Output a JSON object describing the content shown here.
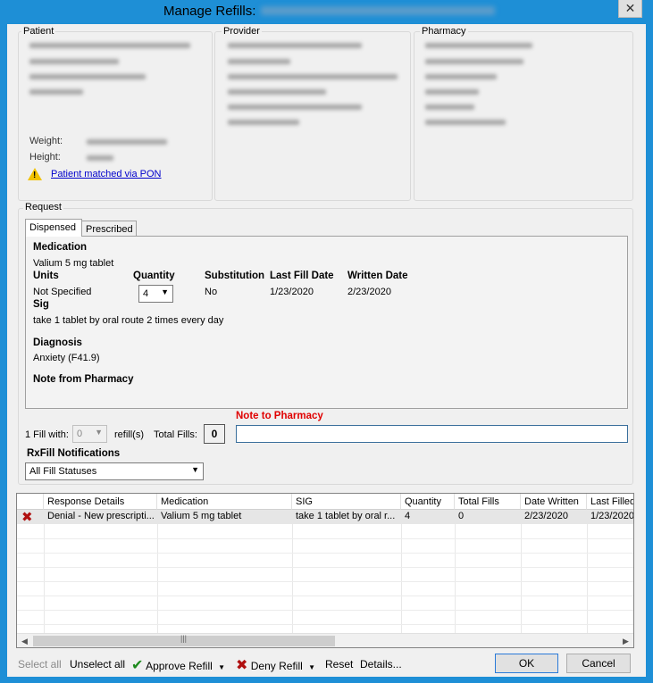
{
  "window": {
    "title": "Manage Refills:",
    "close_glyph": "✕"
  },
  "patient": {
    "label": "Patient",
    "weight_label": "Weight:",
    "height_label": "Height:",
    "matched_link": "Patient matched via PON"
  },
  "provider": {
    "label": "Provider"
  },
  "pharmacy": {
    "label": "Pharmacy"
  },
  "request": {
    "label": "Request",
    "tabs": [
      {
        "label": "Dispensed",
        "active": true
      },
      {
        "label": "Prescribed",
        "active": false
      }
    ],
    "medication_label": "Medication",
    "medication_value": "Valium 5 mg tablet",
    "units_label": "Units",
    "units_value": "Not Specified",
    "quantity_label": "Quantity",
    "quantity_value": "4",
    "substitution_label": "Substitution",
    "substitution_value": "No",
    "last_fill_label": "Last Fill Date",
    "last_fill_value": "1/23/2020",
    "written_label": "Written Date",
    "written_value": "2/23/2020",
    "sig_label": "Sig",
    "sig_value": "take 1 tablet by oral route 2 times every day",
    "diagnosis_label": "Diagnosis",
    "diagnosis_value": "Anxiety (F41.9)",
    "note_from_pharmacy_label": "Note from Pharmacy",
    "fill_with_label": "1 Fill with:",
    "fill_with_value": "0",
    "refills_label": "refill(s)",
    "total_fills_label": "Total Fills:",
    "total_fills_value": "0",
    "note_to_pharmacy_label": "Note to Pharmacy",
    "note_to_pharmacy_value": "",
    "rxfill_label": "RxFill Notifications",
    "rxfill_value": "All Fill Statuses"
  },
  "grid": {
    "columns": [
      "Response Details",
      "Medication",
      "SIG",
      "Quantity",
      "Total Fills",
      "Date Written",
      "Last Filled"
    ],
    "rows": [
      {
        "status_icon": "denial-x-icon",
        "response": "Denial - New prescripti...",
        "medication": "Valium 5 mg tablet",
        "sig": "take 1 tablet by oral r...",
        "quantity": "4",
        "total_fills": "0",
        "date_written": "2/23/2020",
        "last_filled": "1/23/2020"
      }
    ]
  },
  "toolbar": {
    "select_all": "Select all",
    "unselect_all": "Unselect all",
    "approve": "Approve Refill",
    "deny": "Deny Refill",
    "reset": "Reset",
    "details": "Details...",
    "ok": "OK",
    "cancel": "Cancel"
  }
}
